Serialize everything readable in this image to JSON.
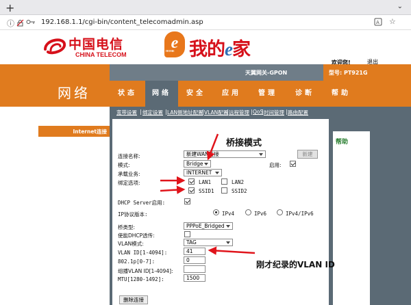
{
  "browser": {
    "url": "192.168.1.1/cgi-bin/content_telecomadmin.asp"
  },
  "header": {
    "brand_cn": "中国电信",
    "brand_en": "CHINA TELECOM",
    "home_logo": "我的",
    "home_logo_e": "e",
    "home_logo_tail": "家",
    "home_logo_badge": "HOME",
    "welcome": "欢迎您!",
    "logout": "退出",
    "gateway_name": "天翼网关-GPON",
    "model": "型号: PT921G"
  },
  "section_title": "网络",
  "menu": [
    {
      "label": "状态"
    },
    {
      "label": "网络"
    },
    {
      "label": "安全"
    },
    {
      "label": "应用"
    },
    {
      "label": "管理"
    },
    {
      "label": "诊断"
    },
    {
      "label": "帮助"
    }
  ],
  "submenu": [
    {
      "label": "宽带设置"
    },
    {
      "label": "绑定设置"
    },
    {
      "label": "LAN侧地址配置"
    },
    {
      "label": "VLAN配置"
    },
    {
      "label": "远程管理"
    },
    {
      "label": "QoS"
    },
    {
      "label": "时间管理"
    },
    {
      "label": "路由配置"
    }
  ],
  "sidebar": {
    "current": "Internet连接"
  },
  "help": {
    "title": "帮助"
  },
  "form": {
    "conn_name_label": "连接名称:",
    "conn_name_value": "新建WAN连接",
    "new_button": "新建",
    "mode_label": "模式:",
    "mode_value": "Bridge",
    "enable_label": "启用:",
    "service_label": "承载业务:",
    "service_value": "INTERNET",
    "bind_label": "绑定选项:",
    "lan1": "LAN1",
    "lan2": "LAN2",
    "ssid1": "SSID1",
    "ssid2": "SSID2",
    "dhcp_label": "DHCP Server启用:",
    "ip_ver_label": "IP协议版本:",
    "ipv4": "IPv4",
    "ipv6": "IPv6",
    "ipv4v6": "IPv4/IPv6",
    "bridge_type_label": "桥类型:",
    "bridge_type_value": "PPPoE_Bridged",
    "dhcp_pass_label": "使能DHCP透传:",
    "vlan_mode_label": "VLAN模式:",
    "vlan_mode_value": "TAG",
    "vlan_id_label": "VLAN ID[1-4094]:",
    "vlan_id_value": "41",
    "p8021_label": "802.1p[0-7]:",
    "p8021_value": "0",
    "mcast_vlan_label": "组播VLAN ID[1-4094]:",
    "mcast_vlan_value": "",
    "mtu_label": "MTU[1280-1492]:",
    "mtu_value": "1500",
    "delete_button": "删除连接"
  },
  "annotations": {
    "bridge_mode": "桥接模式",
    "vlan_note": "刚才纪录的VLAN ID"
  },
  "colors": {
    "orange": "#e07b1e",
    "slate": "#5b6a75",
    "telecom_red": "#d6101a",
    "arrow_red": "#e0141b"
  }
}
